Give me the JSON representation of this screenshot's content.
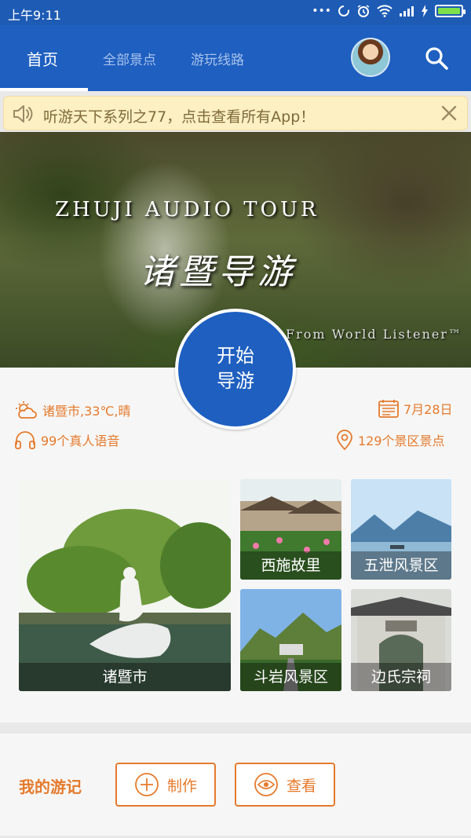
{
  "status_bar": {
    "time": "上午9:11",
    "dots": "•••"
  },
  "app_bar": {
    "tabs": [
      {
        "label": "首页",
        "active": true
      },
      {
        "label": "全部景点",
        "active": false
      },
      {
        "label": "游玩线路",
        "active": false
      }
    ]
  },
  "notice": {
    "text": "听游天下系列之77，点击查看所有App！"
  },
  "hero": {
    "title_en": "ZHUJI AUDIO TOUR",
    "title_cn": "诸暨导游",
    "credit": "From World Listener™"
  },
  "start_button": {
    "line1": "开始",
    "line2": "导游"
  },
  "info": {
    "weather": "诸暨市,33℃,晴",
    "date": "7月28日",
    "voices": "99个真人语音",
    "spots": "129个景区景点"
  },
  "spots": [
    {
      "name": "诸暨市"
    },
    {
      "name": "西施故里"
    },
    {
      "name": "五泄风景区"
    },
    {
      "name": "斗岩风景区"
    },
    {
      "name": "边氏宗祠"
    }
  ],
  "diary": {
    "title": "我的游记",
    "make_label": "制作",
    "view_label": "查看"
  },
  "colors": {
    "primary": "#1e5fc0",
    "accent": "#e57a2c",
    "notice_bg": "#fdf0c2"
  },
  "icons": [
    "speaker-icon",
    "close-icon",
    "search-icon",
    "weather-icon",
    "calendar-icon",
    "headphones-icon",
    "location-pin-icon",
    "plus-circle-icon",
    "eye-icon"
  ]
}
